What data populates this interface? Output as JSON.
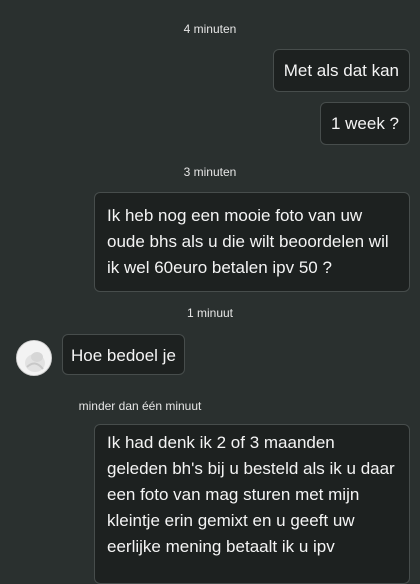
{
  "chat": {
    "timestamps": {
      "t1": "4 minuten",
      "t2": "3 minuten",
      "t3": "1 minuut",
      "t4": "minder dan één minuut"
    },
    "messages": {
      "m1": "Met als dat kan",
      "m2": "1 week ?",
      "m3": "Ik heb nog een mooie foto van uw oude bhs als u die wilt beoordelen wil ik wel 60euro betalen ipv 50 ?",
      "m4": "Hoe bedoel je",
      "m5": "Ik had denk ik 2 of 3 maanden geleden bh's bij u besteld als ik u daar een foto van mag sturen met mijn kleintje erin gemixt en u geeft uw eerlijke mening betaalt ik u ipv"
    }
  }
}
